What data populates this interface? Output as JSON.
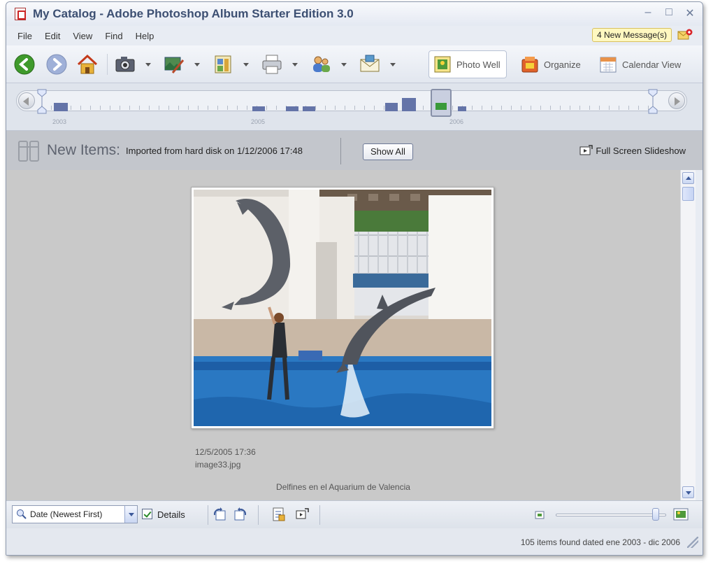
{
  "window": {
    "title": "My Catalog - Adobe Photoshop Album Starter Edition 3.0",
    "controls": [
      "–",
      "□",
      "✕"
    ]
  },
  "menu": {
    "items": [
      "File",
      "Edit",
      "View",
      "Find",
      "Help"
    ],
    "messages": "4 New Message(s)"
  },
  "toolbar": {
    "modes": {
      "photo_well": "Photo Well",
      "organize": "Organize",
      "calendar_view": "Calendar View"
    }
  },
  "timeline": {
    "years": [
      "2003",
      "2005",
      "2006"
    ],
    "bars": [
      {
        "level": 0.55
      },
      {
        "level": 0.3
      },
      {
        "level": 0.3
      },
      {
        "level": 0.3
      },
      {
        "level": 0.55
      },
      {
        "level": 0.85
      },
      {
        "level": 0.3
      }
    ]
  },
  "header": {
    "title": "New Items:",
    "subtitle": "Imported from hard disk on 1/12/2006 17:48",
    "show_all": "Show All",
    "fullscreen": "Full Screen Slideshow"
  },
  "photo": {
    "date": "12/5/2005 17:36",
    "filename": "image33.jpg",
    "caption": "Delfines en el Aquarium de Valencia"
  },
  "bottombar": {
    "sort": "Date (Newest First)",
    "details": "Details",
    "zoom": 0.93
  },
  "status": {
    "text": "105 items found dated ene 2003 - dic 2006"
  },
  "colors": {
    "accent": "#3c4f72",
    "timeline_bar": "#6474a8",
    "band": "#c3c6cc",
    "well": "#c9c9c9"
  }
}
